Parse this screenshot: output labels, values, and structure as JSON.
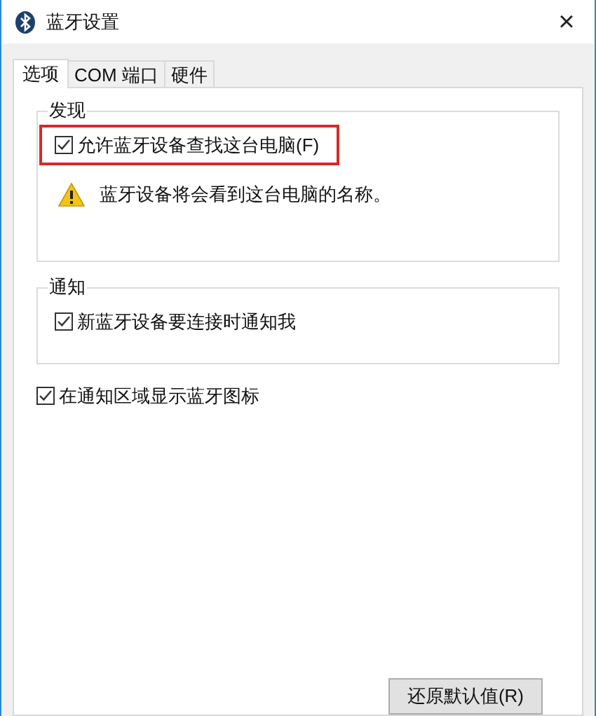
{
  "window": {
    "title": "蓝牙设置",
    "close": "×"
  },
  "tabs": [
    {
      "label": "选项",
      "selected": true
    },
    {
      "label": "COM 端口",
      "selected": false
    },
    {
      "label": "硬件",
      "selected": false
    }
  ],
  "groups": [
    {
      "legend": "发现",
      "items": [
        {
          "kind": "checkbox",
          "label": "允许蓝牙设备查找这台电脑(F)",
          "checked": true,
          "highlighted": true
        },
        {
          "kind": "warning",
          "label": "蓝牙设备将会看到这台电脑的名称。"
        }
      ]
    },
    {
      "legend": "通知",
      "items": [
        {
          "kind": "checkbox",
          "label": "新蓝牙设备要连接时通知我",
          "checked": true,
          "highlighted": false
        }
      ]
    }
  ],
  "options": [
    {
      "label": "在通知区域显示蓝牙图标",
      "checked": true
    }
  ],
  "buttons": [
    "还原默认值(R)"
  ]
}
